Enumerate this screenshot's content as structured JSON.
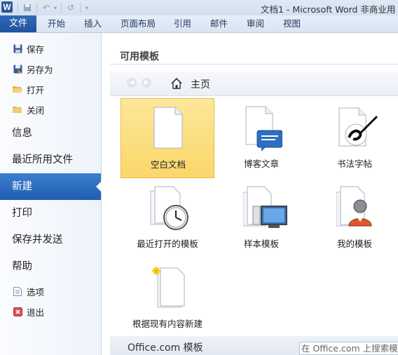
{
  "window": {
    "app_icon_letter": "W",
    "title": "文档1 - Microsoft Word 非商业用"
  },
  "ribbon": {
    "file_tab": "文件",
    "tabs": [
      "开始",
      "插入",
      "页面布局",
      "引用",
      "邮件",
      "审阅",
      "视图"
    ]
  },
  "nav": {
    "commands_top": [
      {
        "label": "保存",
        "icon": "save-icon"
      },
      {
        "label": "另存为",
        "icon": "save-as-icon"
      },
      {
        "label": "打开",
        "icon": "open-folder-icon"
      },
      {
        "label": "关闭",
        "icon": "close-folder-icon"
      }
    ],
    "pages": [
      "信息",
      "最近所用文件",
      "新建",
      "打印",
      "保存并发送",
      "帮助"
    ],
    "selected_page": "新建",
    "commands_bottom": [
      {
        "label": "选项",
        "icon": "options-icon"
      },
      {
        "label": "退出",
        "icon": "exit-icon"
      }
    ]
  },
  "main": {
    "section_title": "可用模板",
    "breadcrumb_home": "主页",
    "templates": [
      {
        "label": "空白文档",
        "icon": "blank-document-icon",
        "selected": true
      },
      {
        "label": "博客文章",
        "icon": "blog-post-icon",
        "selected": false
      },
      {
        "label": "书法字帖",
        "icon": "calligraphy-icon",
        "selected": false
      },
      {
        "label": "最近打开的模板",
        "icon": "recent-templates-icon",
        "selected": false
      },
      {
        "label": "样本模板",
        "icon": "sample-templates-icon",
        "selected": false
      },
      {
        "label": "我的模板",
        "icon": "my-templates-icon",
        "selected": false
      },
      {
        "label": "根据现有内容新建",
        "icon": "new-from-existing-icon",
        "selected": false
      }
    ],
    "office_section_title": "Office.com 模板",
    "search_placeholder": "在 Office.com 上搜索模板"
  }
}
